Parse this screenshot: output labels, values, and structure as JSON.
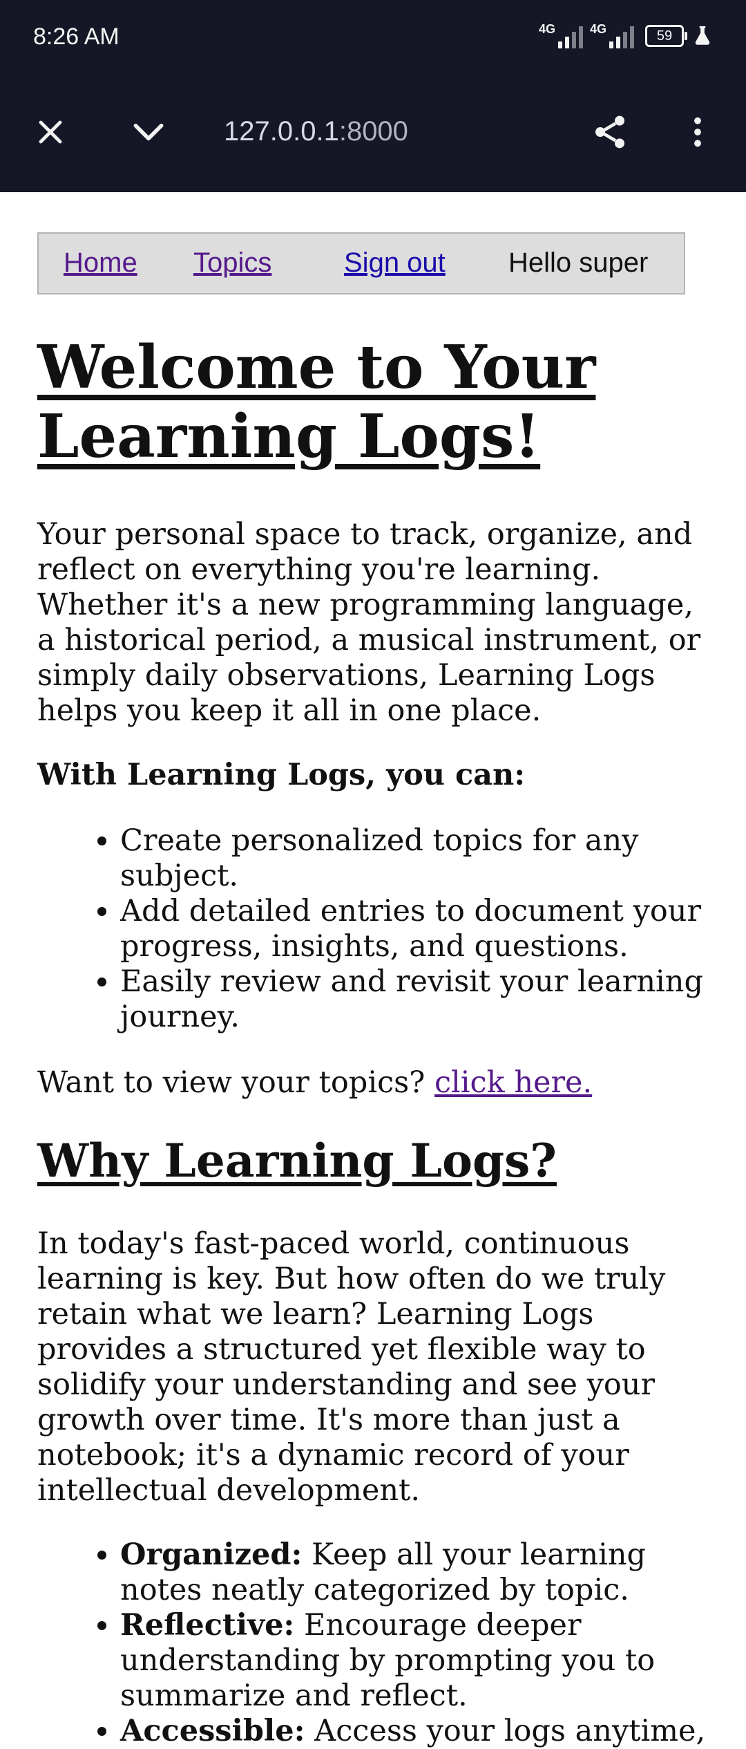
{
  "status_bar": {
    "time": "8:26 AM",
    "network_1": "4G",
    "network_2": "4G",
    "battery": "59"
  },
  "browser": {
    "url_host": "127.0.0.1",
    "url_port": ":8000",
    "icons": [
      "close-icon",
      "chevron-down-icon",
      "share-icon",
      "more-vert-icon"
    ]
  },
  "nav": {
    "home": "Home",
    "topics": "Topics",
    "sign_out": "Sign out",
    "greeting": "Hello super"
  },
  "content": {
    "title": "Welcome to Your Learning Logs!",
    "intro": "Your personal space to track, organize, and reflect on everything you're learning. Whether it's a new programming language, a historical period, a musical instrument, or simply daily observations, Learning Logs helps you keep it all in one place.",
    "can_heading": "With Learning Logs, you can:",
    "can_items": [
      "Create personalized topics for any subject.",
      "Add detailed entries to document your progress, insights, and questions.",
      "Easily review and revisit your learning journey."
    ],
    "want_text": "Want to view your topics? ",
    "want_link": "click here.",
    "why_title": "Why Learning Logs?",
    "why_text": "In today's fast-paced world, continuous learning is key. But how often do we truly retain what we learn? Learning Logs provides a structured yet flexible way to solidify your understanding and see your growth over time. It's more than just a notebook; it's a dynamic record of your intellectual development.",
    "features": [
      {
        "label": "Organized:",
        "text": " Keep all your learning notes neatly categorized by topic."
      },
      {
        "label": "Reflective:",
        "text": " Encourage deeper understanding by prompting you to summarize and reflect."
      },
      {
        "label": "Accessible:",
        "text": " Access your logs anytime,"
      }
    ]
  }
}
